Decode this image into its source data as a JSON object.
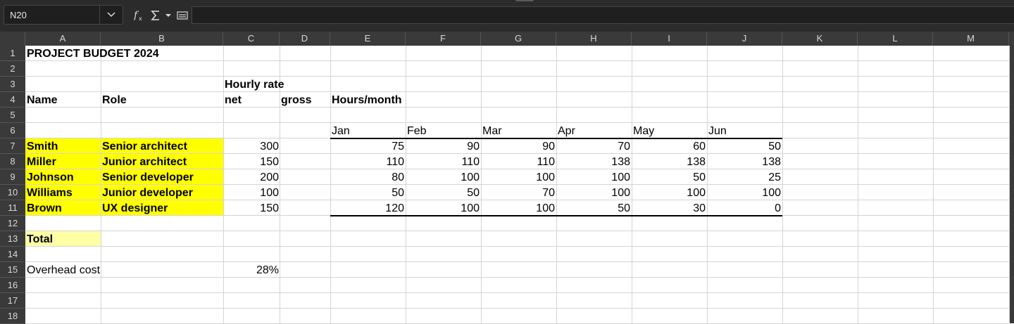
{
  "namebox": {
    "value": "N20"
  },
  "toolbar": {
    "icons": [
      "function-wizard-icon",
      "sum-icon",
      "dropdown-arrow-icon",
      "formula-equals-icon"
    ]
  },
  "formula_bar": {
    "value": ""
  },
  "columns": [
    "A",
    "B",
    "C",
    "D",
    "E",
    "F",
    "G",
    "H",
    "I",
    "J",
    "K",
    "L",
    "M"
  ],
  "rows": [
    "1",
    "2",
    "3",
    "4",
    "5",
    "6",
    "7",
    "8",
    "9",
    "10",
    "11",
    "12",
    "13",
    "14",
    "15",
    "16",
    "17",
    "18"
  ],
  "sheet": {
    "title": "PROJECT BUDGET 2024",
    "hourly_rate": "Hourly rate",
    "name_header": "Name",
    "role_header": "Role",
    "net_header": "net",
    "gross_header": "gross",
    "hours_header": "Hours/month",
    "months": [
      "Jan",
      "Feb",
      "Mar",
      "Apr",
      "May",
      "Jun"
    ],
    "staff": [
      {
        "name": "Smith",
        "role": "Senior architect",
        "rate": "300",
        "hours": [
          "75",
          "90",
          "90",
          "70",
          "60",
          "50"
        ]
      },
      {
        "name": "Miller",
        "role": "Junior architect",
        "rate": "150",
        "hours": [
          "110",
          "110",
          "110",
          "138",
          "138",
          "138"
        ]
      },
      {
        "name": "Johnson",
        "role": "Senior developer",
        "rate": "200",
        "hours": [
          "80",
          "100",
          "100",
          "100",
          "50",
          "25"
        ]
      },
      {
        "name": "Williams",
        "role": "Junior developer",
        "rate": "100",
        "hours": [
          "50",
          "50",
          "70",
          "100",
          "100",
          "100"
        ]
      },
      {
        "name": "Brown",
        "role": "UX designer",
        "rate": "150",
        "hours": [
          "120",
          "100",
          "100",
          "50",
          "30",
          "0"
        ]
      }
    ],
    "total_label": "Total",
    "overhead_label": "Overhead cost",
    "overhead_value": "28%"
  },
  "colors": {
    "highlight": "#ffff00",
    "total_highlight": "#ffffa6",
    "header_bg": "#3a3a3a",
    "toolbar_bg": "#2b2b2b"
  }
}
